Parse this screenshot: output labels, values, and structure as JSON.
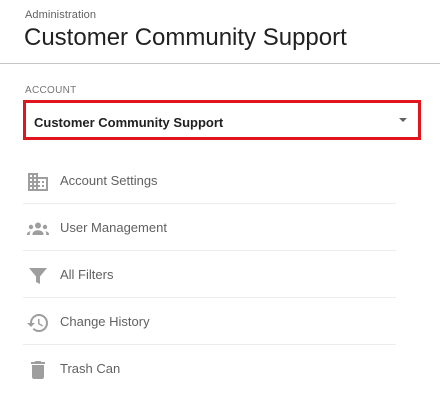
{
  "header": {
    "breadcrumb": "Administration",
    "title": "Customer Community Support"
  },
  "account": {
    "label": "ACCOUNT",
    "selected": "Customer Community Support",
    "highlight_color": "#e0151e"
  },
  "nav": {
    "items": [
      {
        "label": "Account Settings",
        "icon": "building-icon"
      },
      {
        "label": "User Management",
        "icon": "people-icon"
      },
      {
        "label": "All Filters",
        "icon": "filter-icon"
      },
      {
        "label": "Change History",
        "icon": "history-icon"
      },
      {
        "label": "Trash Can",
        "icon": "trash-icon"
      }
    ]
  }
}
